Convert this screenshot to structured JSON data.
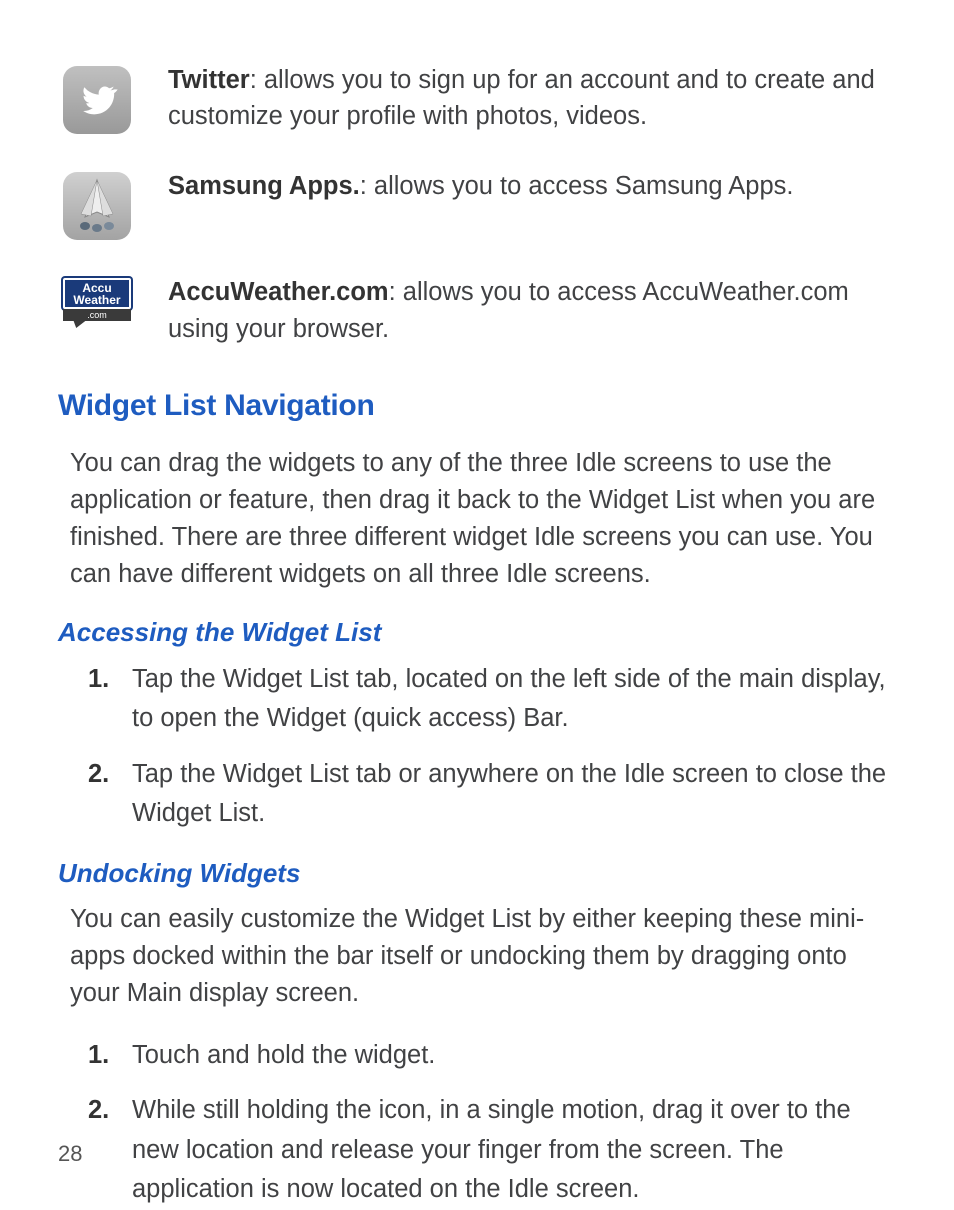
{
  "widgets": [
    {
      "name": "Twitter",
      "desc": ": allows you to sign up for an account and to create and customize your profile with photos, videos."
    },
    {
      "name": "Samsung Apps.",
      "desc": ": allows you to access Samsung Apps."
    },
    {
      "name": "AccuWeather.com",
      "desc": ": allows you to access AccuWeather.com using your browser."
    }
  ],
  "section_heading": "Widget List Navigation",
  "section_intro": "You can drag the widgets to any of the three Idle screens to use the application or feature, then drag it back to the Widget List when you are finished. There are three different widget Idle screens you can use. You can have different widgets on all three Idle screens.",
  "subsections": [
    {
      "heading": "Accessing the Widget List",
      "intro": "",
      "steps": [
        "Tap the Widget List tab, located on the left side of the main display, to open the Widget (quick access) Bar.",
        "Tap the Widget List tab or anywhere on the Idle screen to close the Widget List."
      ]
    },
    {
      "heading": "Undocking Widgets",
      "intro": "You can easily customize the Widget List by either keeping these mini-apps docked within the bar itself or undocking them by dragging onto your Main display screen.",
      "steps": [
        "Touch and hold the widget.",
        "While still holding the icon, in a single motion, drag it over to the new location and release your finger from the screen. The application is now located on the Idle screen."
      ]
    }
  ],
  "accu_labels": {
    "top1": "Accu",
    "top2": "Weather",
    "bottom": ".com"
  },
  "page_number": "28"
}
